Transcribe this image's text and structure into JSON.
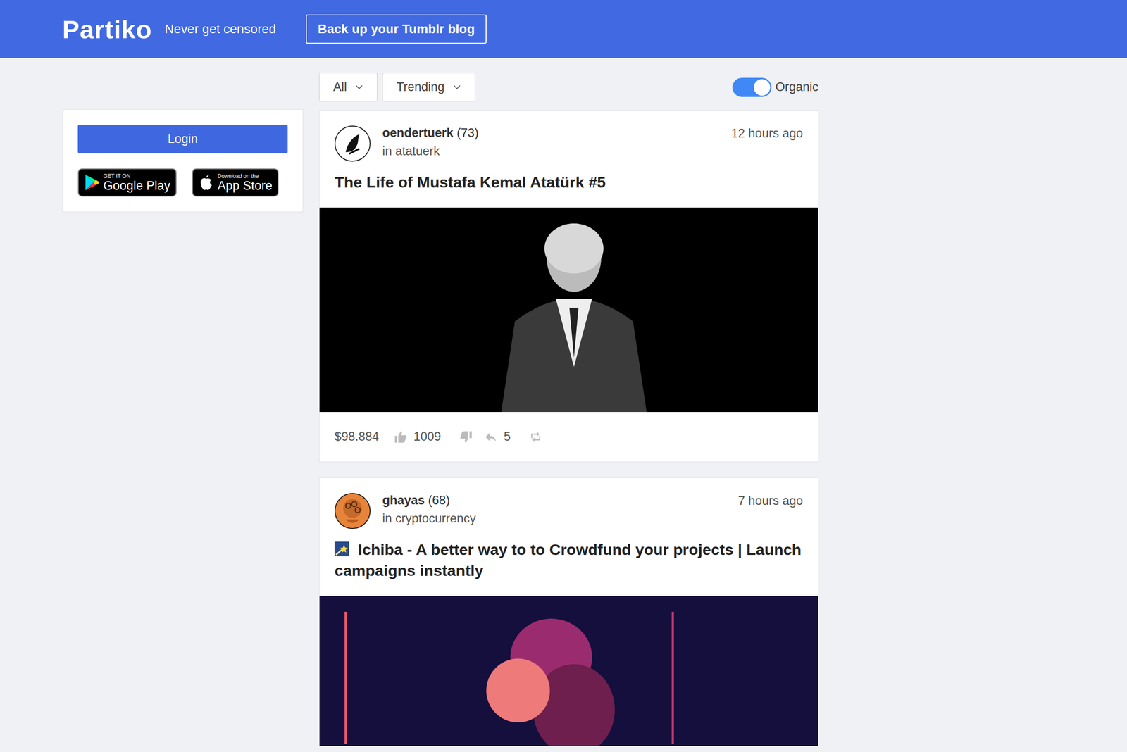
{
  "header": {
    "logo": "Partiko",
    "tagline": "Never get censored",
    "button": "Back up your Tumblr blog"
  },
  "sidebar": {
    "login": "Login",
    "stores": [
      {
        "kind": "google",
        "small": "GET IT ON",
        "name": "Google Play"
      },
      {
        "kind": "apple",
        "small": "Download on the",
        "name": "App Store"
      }
    ]
  },
  "filters": [
    {
      "label": "All"
    },
    {
      "label": "Trending"
    }
  ],
  "toggle": {
    "label": "Organic",
    "on": true
  },
  "posts": [
    {
      "author": "oendertuerk",
      "reputation": "(73)",
      "community": "in atatuerk",
      "time": "12 hours ago",
      "title": "The Life of Mustafa Kemal Atatürk #5",
      "title_icon": false,
      "avatar": "#ffffff",
      "image": "photo",
      "footer": {
        "value": "$98.884",
        "likes": "1009",
        "replies": "5"
      }
    },
    {
      "author": "ghayas",
      "reputation": "(68)",
      "community": "in cryptocurrency",
      "time": "7 hours ago",
      "title": "Ichiba - A better way to to Crowdfund your projects | Launch campaigns instantly",
      "title_icon": true,
      "avatar": "#e8843a",
      "image": "infographic",
      "footer": null
    }
  ]
}
